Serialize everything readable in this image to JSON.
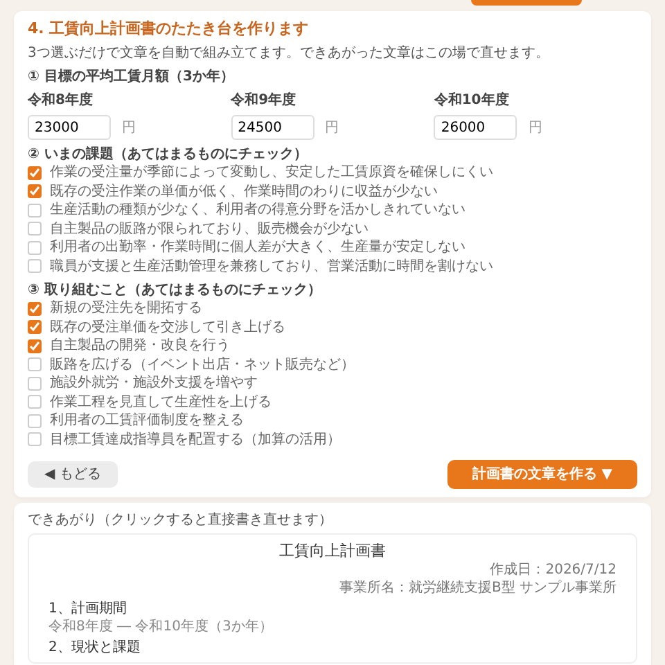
{
  "step": {
    "title": "4. 工賃向上計画書のたたき台を作ります",
    "description": "3つ選ぶだけで文章を自動で組み立てます。できあがった文章はこの場で直せます。",
    "wage_target": {
      "title": "① 目標の平均工賃月額（3か年）",
      "years": [
        {
          "label": "令和8年度",
          "value": "23000",
          "unit": "円"
        },
        {
          "label": "令和9年度",
          "value": "24500",
          "unit": "円"
        },
        {
          "label": "令和10年度",
          "value": "26000",
          "unit": "円"
        }
      ]
    },
    "issues": {
      "title": "② いまの課題（あてはまるものにチェック）",
      "items": [
        {
          "label": "作業の受注量が季節によって変動し、安定した工賃原資を確保しにくい",
          "checked": true
        },
        {
          "label": "既存の受注作業の単価が低く、作業時間のわりに収益が少ない",
          "checked": true
        },
        {
          "label": "生産活動の種類が少なく、利用者の得意分野を活かしきれていない",
          "checked": false
        },
        {
          "label": "自主製品の販路が限られており、販売機会が少ない",
          "checked": false
        },
        {
          "label": "利用者の出勤率・作業時間に個人差が大きく、生産量が安定しない",
          "checked": false
        },
        {
          "label": "職員が支援と生産活動管理を兼務しており、営業活動に時間を割けない",
          "checked": false
        }
      ]
    },
    "actions": {
      "title": "③ 取り組むこと（あてはまるものにチェック）",
      "items": [
        {
          "label": "新規の受注先を開拓する",
          "checked": true
        },
        {
          "label": "既存の受注単価を交渉して引き上げる",
          "checked": true
        },
        {
          "label": "自主製品の開発・改良を行う",
          "checked": true
        },
        {
          "label": "販路を広げる（イベント出店・ネット販売など）",
          "checked": false
        },
        {
          "label": "施設外就労・施設外支援を増やす",
          "checked": false
        },
        {
          "label": "作業工程を見直して生産性を上げる",
          "checked": false
        },
        {
          "label": "利用者の工賃評価制度を整える",
          "checked": false
        },
        {
          "label": "目標工賃達成指導員を配置する（加算の活用）",
          "checked": false
        }
      ]
    },
    "back_button": "◀ もどる",
    "generate_button": "計画書の文章を作る ▼"
  },
  "result": {
    "label": "できあがり（クリックすると直接書き直せます）",
    "document": {
      "title": "工賃向上計画書",
      "date": "作成日：2026/7/12",
      "office": "事業所名：就労継続支援B型 サンプル事業所",
      "sections": [
        {
          "heading": "1、計画期間",
          "body": "令和8年度 ― 令和10年度（3か年）"
        },
        {
          "heading": "2、現状と課題"
        }
      ]
    }
  }
}
